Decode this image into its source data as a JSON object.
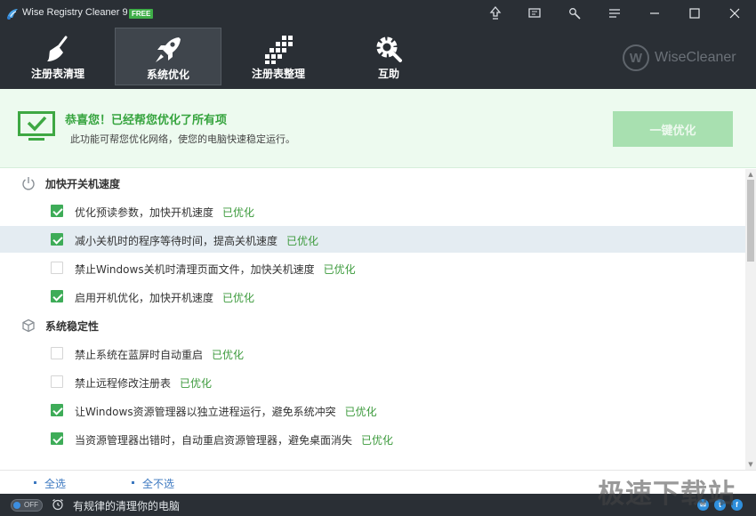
{
  "app": {
    "title": "Wise Registry Cleaner 9",
    "badge": "FREE"
  },
  "titlebar": {
    "icons": [
      "upgrade-icon",
      "feedback-icon",
      "tools-icon",
      "menu-icon"
    ],
    "window_buttons": [
      "minimize-icon",
      "maximize-icon",
      "close-icon"
    ]
  },
  "tabs": [
    {
      "label": "注册表清理",
      "icon": "broom-icon",
      "active": false
    },
    {
      "label": "系统优化",
      "icon": "rocket-icon",
      "active": true
    },
    {
      "label": "注册表整理",
      "icon": "defrag-blocks-icon",
      "active": false
    },
    {
      "label": "互助",
      "icon": "gear-help-icon",
      "active": false
    }
  ],
  "brand": {
    "mark": "W",
    "name": "WiseCleaner"
  },
  "banner": {
    "title": "恭喜您！已经帮您优化了所有项",
    "description": "此功能可帮您优化网络，使您的电脑快速稳定运行。",
    "button_label": "一键优化",
    "icon": "monitor-check-icon"
  },
  "sections": [
    {
      "title": "加快开关机速度",
      "icon": "power-icon",
      "items": [
        {
          "text": "优化预读参数，加快开机速度",
          "status": "已优化",
          "checked": true,
          "highlight": false
        },
        {
          "text": "减小关机时的程序等待时间，提高关机速度",
          "status": "已优化",
          "checked": true,
          "highlight": true
        },
        {
          "text": "禁止Windows关机时清理页面文件，加快关机速度",
          "status": "已优化",
          "checked": false,
          "highlight": false
        },
        {
          "text": "启用开机优化，加快开机速度",
          "status": "已优化",
          "checked": true,
          "highlight": false
        }
      ]
    },
    {
      "title": "系统稳定性",
      "icon": "cube-icon",
      "items": [
        {
          "text": "禁止系统在蓝屏时自动重启",
          "status": "已优化",
          "checked": false,
          "highlight": false
        },
        {
          "text": "禁止远程修改注册表",
          "status": "已优化",
          "checked": false,
          "highlight": false
        },
        {
          "text": "让Windows资源管理器以独立进程运行，避免系统冲突",
          "status": "已优化",
          "checked": true,
          "highlight": false
        },
        {
          "text": "当资源管理器出错时，自动重启资源管理器，避免桌面消失",
          "status": "已优化",
          "checked": true,
          "highlight": false
        }
      ]
    }
  ],
  "selection": {
    "select_all": "全选",
    "select_none": "全不选"
  },
  "footer": {
    "toggle_label": "OFF",
    "schedule_text": "有规律的清理你的电脑",
    "social": [
      "email-icon",
      "twitter-icon",
      "facebook-icon"
    ]
  },
  "watermark": "极速下载站",
  "colors": {
    "accent_green": "#3eac58",
    "titlebar": "#2a2f35",
    "link_blue": "#3c78c0"
  }
}
